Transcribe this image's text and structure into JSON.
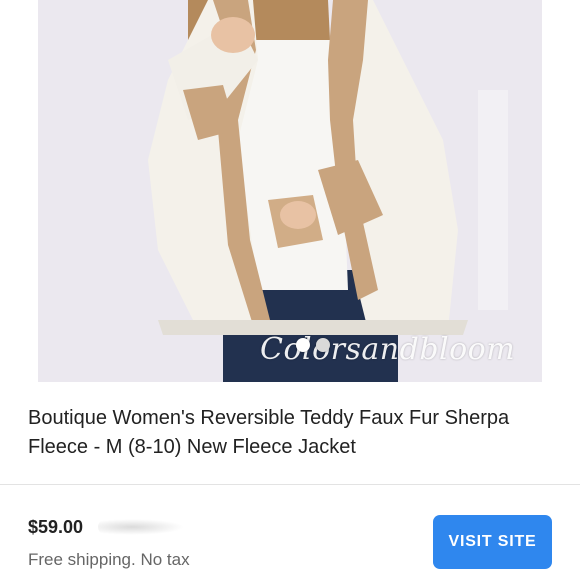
{
  "product": {
    "image_alt": "Model wearing white sherpa fleece jacket with tan trim",
    "watermark": "Colorsandbloom",
    "carousel": {
      "count": 2,
      "active": 1
    },
    "title": "Boutique Women's Reversible Teddy Faux Fur Sherpa Fleece - M (8-10) New Fleece Jacket"
  },
  "listing": {
    "price": "$59.00",
    "shipping": "Free shipping. No tax",
    "button_label": "VISIT SITE"
  },
  "colors": {
    "button": "#2f87ee",
    "title_text": "#222222",
    "secondary_text": "#666666",
    "jacket_white": "#f4f1ea",
    "jacket_tan": "#c9a47e",
    "jeans": "#22314f"
  }
}
